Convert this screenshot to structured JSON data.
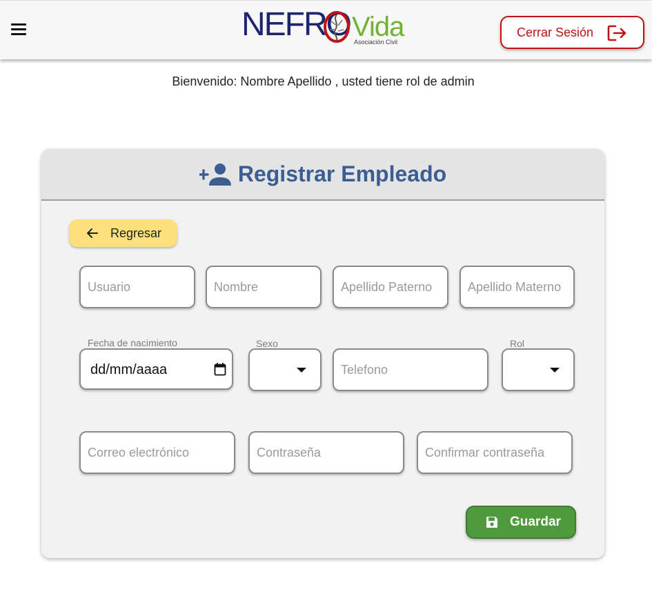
{
  "header": {
    "logo_primary": "NEFRO",
    "logo_secondary": "Vida",
    "logo_sub": "Asociación Civil",
    "logout_label": "Cerrar Sesión"
  },
  "welcome": {
    "text": "Bienvenido: Nombre Apellido , usted tiene rol de admin"
  },
  "card": {
    "title": "Registrar Empleado",
    "back_label": "Regresar",
    "save_label": "Guardar"
  },
  "form": {
    "usuario_placeholder": "Usuario",
    "nombre_placeholder": "Nombre",
    "apellido_paterno_placeholder": "Apellido Paterno",
    "apellido_materno_placeholder": "Apellido Materno",
    "fecha_label": "Fecha de nacimiento",
    "fecha_value": "dd/mm/aaaa",
    "sexo_label": "Sexo",
    "telefono_placeholder": "Telefono",
    "rol_label": "Rol",
    "correo_placeholder": "Correo electrónico",
    "contrasena_placeholder": "Contraseña",
    "confirmar_placeholder": "Confirmar contraseña"
  },
  "colors": {
    "title": "#3c5d91",
    "logout": "#c11212",
    "back_button": "#fce07b",
    "save_button": "#4e9a3c"
  }
}
